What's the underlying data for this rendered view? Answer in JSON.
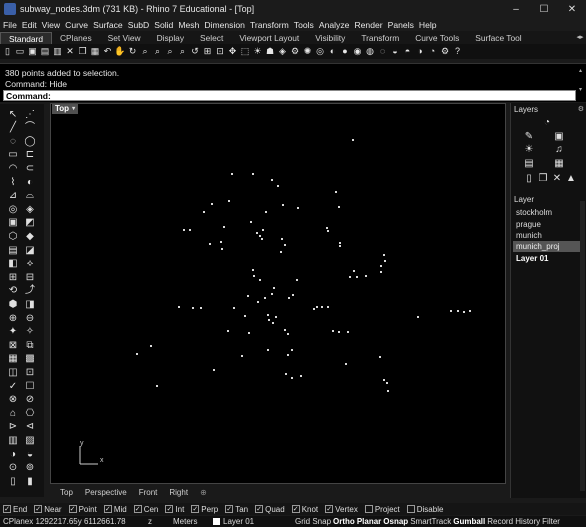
{
  "window": {
    "title": "subway_nodes.3dm (731 KB) - Rhino 7 Educational - [Top]",
    "controls": [
      "–",
      "☐",
      "✕"
    ]
  },
  "menu": [
    "File",
    "Edit",
    "View",
    "Curve",
    "Surface",
    "SubD",
    "Solid",
    "Mesh",
    "Dimension",
    "Transform",
    "Tools",
    "Analyze",
    "Render",
    "Panels",
    "Help"
  ],
  "toolbar_tabs": [
    "Standard",
    "CPlanes",
    "Set View",
    "Display",
    "Select",
    "Viewport Layout",
    "Visibility",
    "Transform",
    "Curve Tools",
    "Surface Tool"
  ],
  "toolbar_tab_active": "Standard",
  "command": {
    "history": [
      "380 points added to selection.",
      "Command: Hide"
    ],
    "prompt": "Command:"
  },
  "viewport": {
    "name": "Top",
    "axis_x": "x",
    "axis_y": "y",
    "tabs": [
      "Top",
      "Perspective",
      "Front",
      "Right"
    ]
  },
  "layers_panel": {
    "title": "Layers",
    "column_header": "Layer",
    "layers": [
      {
        "name": "stockholm",
        "state": "normal"
      },
      {
        "name": "prague",
        "state": "normal"
      },
      {
        "name": "munich",
        "state": "normal"
      },
      {
        "name": "munich_proj",
        "state": "selected"
      },
      {
        "name": "Layer 01",
        "state": "current"
      }
    ]
  },
  "osnap": [
    {
      "label": "End",
      "checked": true
    },
    {
      "label": "Near",
      "checked": true
    },
    {
      "label": "Point",
      "checked": true
    },
    {
      "label": "Mid",
      "checked": true
    },
    {
      "label": "Cen",
      "checked": true
    },
    {
      "label": "Int",
      "checked": true
    },
    {
      "label": "Perp",
      "checked": true
    },
    {
      "label": "Tan",
      "checked": true
    },
    {
      "label": "Quad",
      "checked": true
    },
    {
      "label": "Knot",
      "checked": true
    },
    {
      "label": "Vertex",
      "checked": true
    },
    {
      "label": "Project",
      "checked": false
    },
    {
      "label": "Disable",
      "checked": false
    }
  ],
  "status": {
    "coords": "CPlanex 1292217.65y 6112661.78",
    "z": "z",
    "units": "Meters",
    "layer": "Layer 01",
    "toggles": [
      {
        "label": "Grid Snap",
        "on": false
      },
      {
        "label": "Ortho",
        "on": true
      },
      {
        "label": "Planar",
        "on": true
      },
      {
        "label": "Osnap",
        "on": true
      },
      {
        "label": "SmartTrack",
        "on": false
      },
      {
        "label": "Gumball",
        "on": true
      },
      {
        "label": "Record History",
        "on": false
      },
      {
        "label": "Filter",
        "on": false
      }
    ]
  },
  "colors": {
    "viewport_bg": "#000000",
    "point_color": "#d9d9d9",
    "selected_layer": "#555555"
  }
}
